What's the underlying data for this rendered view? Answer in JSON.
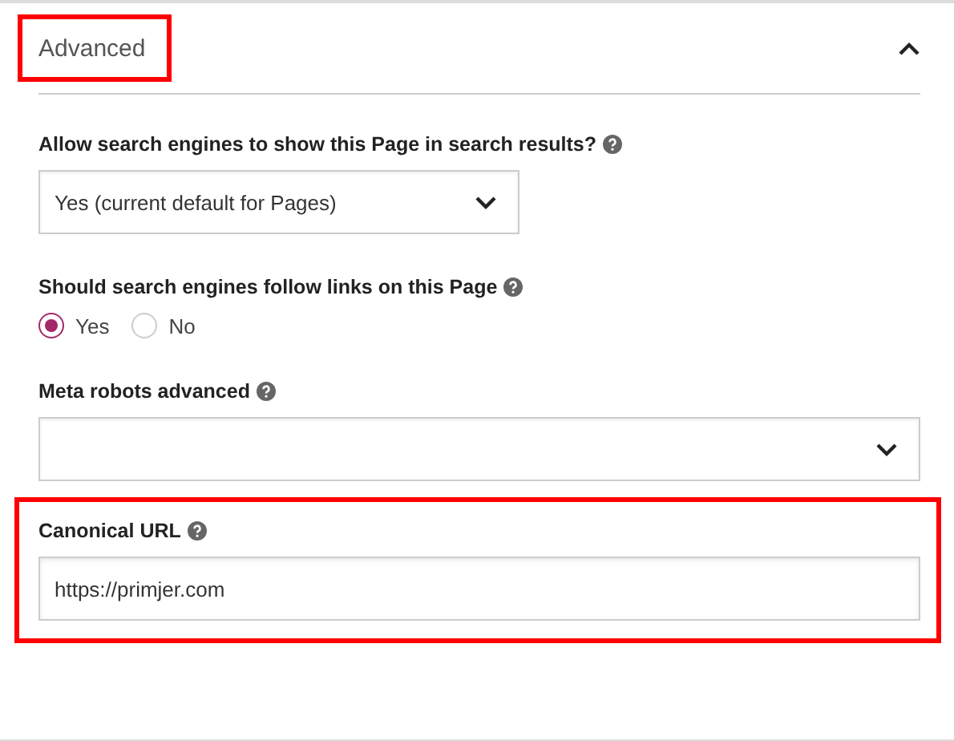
{
  "panel": {
    "title": "Advanced",
    "expanded": true,
    "highlighted": true
  },
  "fields": [
    {
      "kind": "select",
      "label": "Allow search engines to show this Page in search results?",
      "help": true,
      "value": "Yes (current default for Pages)",
      "wide": false
    },
    {
      "kind": "radio",
      "label": "Should search engines follow links on this Page",
      "help": true,
      "options": [
        {
          "label": "Yes",
          "selected": true
        },
        {
          "label": "No",
          "selected": false
        }
      ]
    },
    {
      "kind": "select",
      "label": "Meta robots advanced",
      "help": true,
      "wide": true
    },
    {
      "kind": "text",
      "label": "Canonical URL",
      "help": true,
      "value": "https://primjer.com",
      "highlighted": true
    }
  ]
}
